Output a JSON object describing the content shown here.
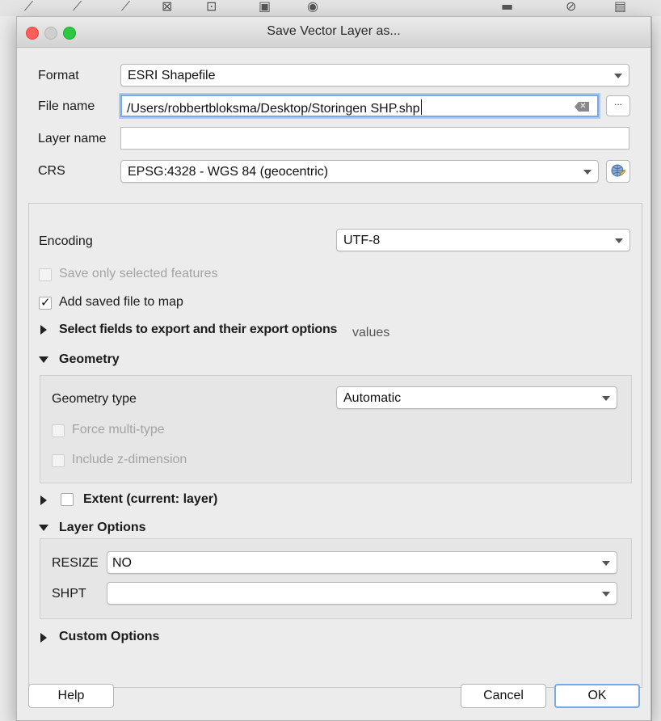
{
  "window": {
    "title": "Save Vector Layer as..."
  },
  "form": {
    "format_label": "Format",
    "format_value": "ESRI Shapefile",
    "filename_label": "File name",
    "filename_value": "/Users/robbertbloksma/Desktop/Storingen SHP.shp",
    "browse_label": "...",
    "layername_label": "Layer name",
    "layername_value": "",
    "crs_label": "CRS",
    "crs_value": "EPSG:4328 - WGS 84 (geocentric)"
  },
  "options": {
    "encoding_label": "Encoding",
    "encoding_value": "UTF-8",
    "save_selected_label": "Save only selected features",
    "save_selected_checked": false,
    "add_to_map_label": "Add saved file to map",
    "add_to_map_checked": true,
    "select_fields_label": "Select fields to export and their export options",
    "overlap_text": "values"
  },
  "geometry": {
    "header": "Geometry",
    "type_label": "Geometry type",
    "type_value": "Automatic",
    "force_multi_label": "Force multi-type",
    "include_z_label": "Include z-dimension"
  },
  "extent": {
    "label": "Extent (current: layer)"
  },
  "layer_options": {
    "header": "Layer Options",
    "resize_label": "RESIZE",
    "resize_value": "NO",
    "shpt_label": "SHPT",
    "shpt_value": ""
  },
  "custom_options": {
    "header": "Custom Options"
  },
  "buttons": {
    "help": "Help",
    "cancel": "Cancel",
    "ok": "OK"
  },
  "icons": [
    "close-window-icon",
    "minimize-window-icon",
    "maximize-window-icon",
    "clear-text-icon",
    "crs-globe-icon",
    "checkmark-icon",
    "expand-arrow-icon",
    "collapse-arrow-icon",
    "dropdown-arrow-icon"
  ]
}
